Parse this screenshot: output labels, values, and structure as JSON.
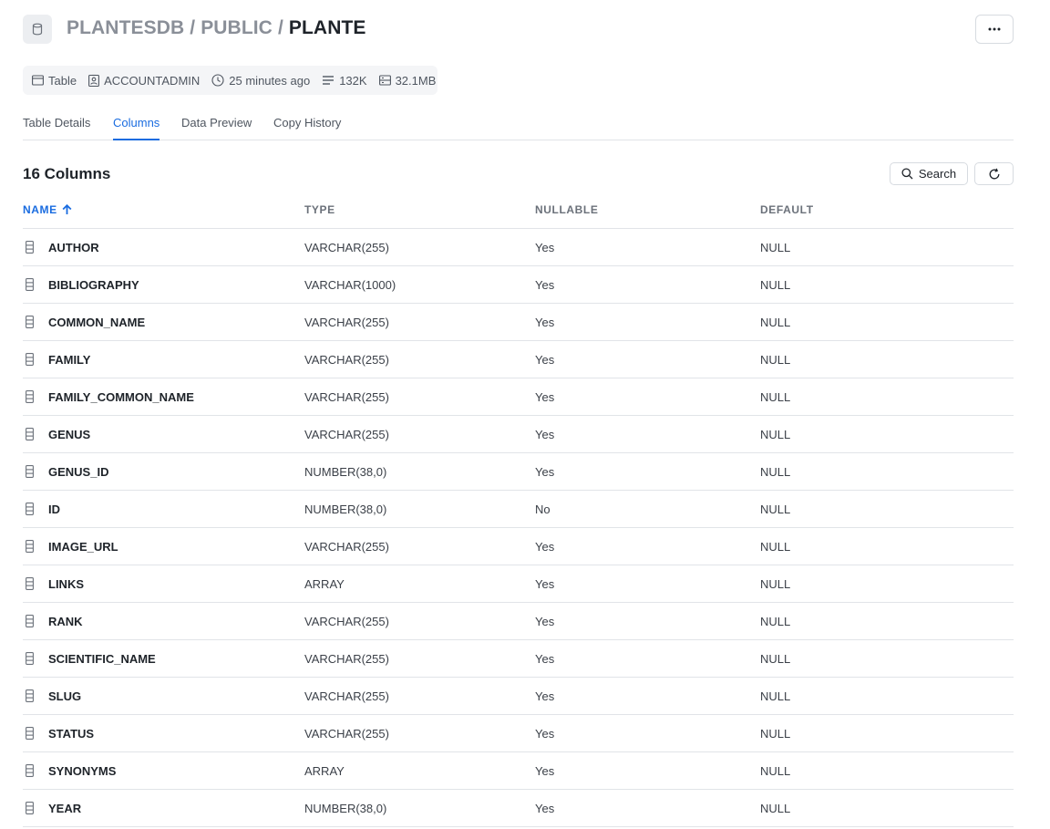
{
  "breadcrumb": {
    "database": "PLANTESDB",
    "schema": "PUBLIC",
    "table": "PLANTE",
    "separator": "/"
  },
  "header": {
    "icon": "database-icon",
    "more_icon": "more-horizontal-icon"
  },
  "meta": {
    "type": {
      "icon": "table-icon",
      "label": "Table"
    },
    "owner": {
      "icon": "role-badge-icon",
      "label": "ACCOUNTADMIN"
    },
    "updated": {
      "icon": "clock-icon",
      "label": "25 minutes ago"
    },
    "rows": {
      "icon": "rows-icon",
      "label": "132K"
    },
    "size": {
      "icon": "storage-icon",
      "label": "32.1MB"
    }
  },
  "tabs": [
    {
      "label": "Table Details",
      "active": false
    },
    {
      "label": "Columns",
      "active": true
    },
    {
      "label": "Data Preview",
      "active": false
    },
    {
      "label": "Copy History",
      "active": false
    }
  ],
  "section": {
    "title": "16 Columns",
    "search_label": "Search",
    "search_icon": "search-icon",
    "refresh_icon": "refresh-icon"
  },
  "columns": {
    "name": "NAME",
    "type": "TYPE",
    "nullable": "NULLABLE",
    "default": "DEFAULT",
    "sort_icon": "arrow-up-icon"
  },
  "rows": [
    {
      "name": "AUTHOR",
      "type": "VARCHAR(255)",
      "nullable": "Yes",
      "default": "NULL"
    },
    {
      "name": "BIBLIOGRAPHY",
      "type": "VARCHAR(1000)",
      "nullable": "Yes",
      "default": "NULL"
    },
    {
      "name": "COMMON_NAME",
      "type": "VARCHAR(255)",
      "nullable": "Yes",
      "default": "NULL"
    },
    {
      "name": "FAMILY",
      "type": "VARCHAR(255)",
      "nullable": "Yes",
      "default": "NULL"
    },
    {
      "name": "FAMILY_COMMON_NAME",
      "type": "VARCHAR(255)",
      "nullable": "Yes",
      "default": "NULL"
    },
    {
      "name": "GENUS",
      "type": "VARCHAR(255)",
      "nullable": "Yes",
      "default": "NULL"
    },
    {
      "name": "GENUS_ID",
      "type": "NUMBER(38,0)",
      "nullable": "Yes",
      "default": "NULL"
    },
    {
      "name": "ID",
      "type": "NUMBER(38,0)",
      "nullable": "No",
      "default": "NULL"
    },
    {
      "name": "IMAGE_URL",
      "type": "VARCHAR(255)",
      "nullable": "Yes",
      "default": "NULL"
    },
    {
      "name": "LINKS",
      "type": "ARRAY",
      "nullable": "Yes",
      "default": "NULL"
    },
    {
      "name": "RANK",
      "type": "VARCHAR(255)",
      "nullable": "Yes",
      "default": "NULL"
    },
    {
      "name": "SCIENTIFIC_NAME",
      "type": "VARCHAR(255)",
      "nullable": "Yes",
      "default": "NULL"
    },
    {
      "name": "SLUG",
      "type": "VARCHAR(255)",
      "nullable": "Yes",
      "default": "NULL"
    },
    {
      "name": "STATUS",
      "type": "VARCHAR(255)",
      "nullable": "Yes",
      "default": "NULL"
    },
    {
      "name": "SYNONYMS",
      "type": "ARRAY",
      "nullable": "Yes",
      "default": "NULL"
    },
    {
      "name": "YEAR",
      "type": "NUMBER(38,0)",
      "nullable": "Yes",
      "default": "NULL"
    }
  ],
  "row_icon": "column-icon",
  "colors": {
    "accent": "#1a6ce0",
    "muted": "#8a8f98",
    "border": "#e1e4e8"
  }
}
